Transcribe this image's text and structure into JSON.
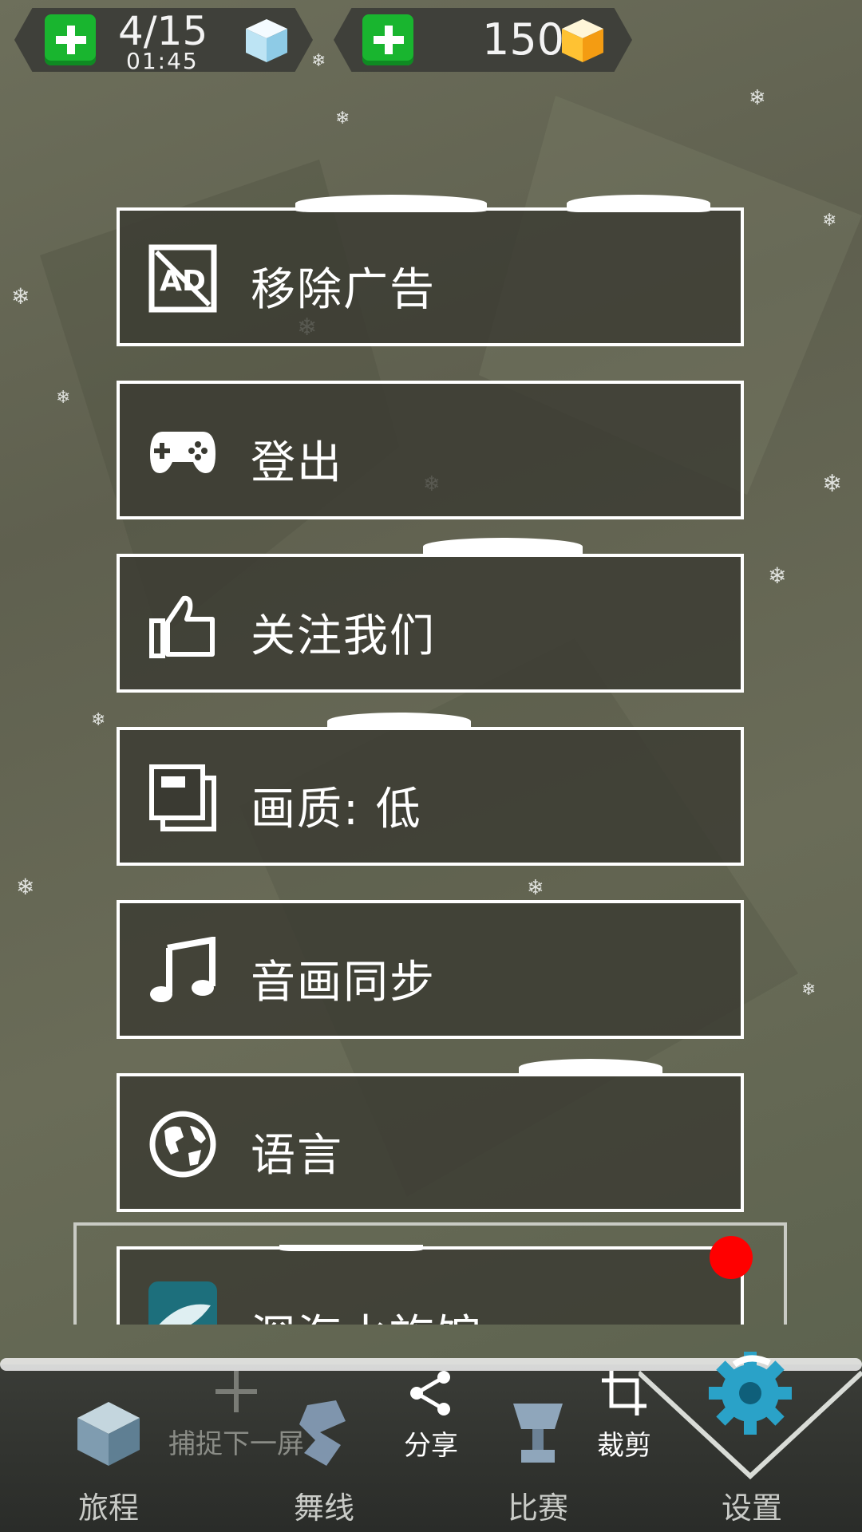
{
  "hud": {
    "lives": "4/15",
    "timer": "01:45",
    "gems": "150"
  },
  "menu": [
    {
      "label": "移除广告",
      "icon": "remove-ads-icon"
    },
    {
      "label": "登出",
      "icon": "gamepad-icon"
    },
    {
      "label": "关注我们",
      "icon": "thumbs-up-icon"
    },
    {
      "label": "画质: 低",
      "icon": "quality-icon"
    },
    {
      "label": "音画同步",
      "icon": "music-note-icon"
    },
    {
      "label": "语言",
      "icon": "globe-icon"
    },
    {
      "label": "深海水族馆",
      "icon": "whale-app-icon"
    }
  ],
  "capture": {
    "next_screen": "捕捉下一屏",
    "share": "分享",
    "crop": "裁剪"
  },
  "nav": [
    {
      "label": "旅程"
    },
    {
      "label": "舞线"
    },
    {
      "label": "比赛"
    },
    {
      "label": "设置"
    }
  ],
  "colors": {
    "accent_green": "#19b52f",
    "notification_red": "#ff0000",
    "settings_blue": "#2aa2c8"
  }
}
